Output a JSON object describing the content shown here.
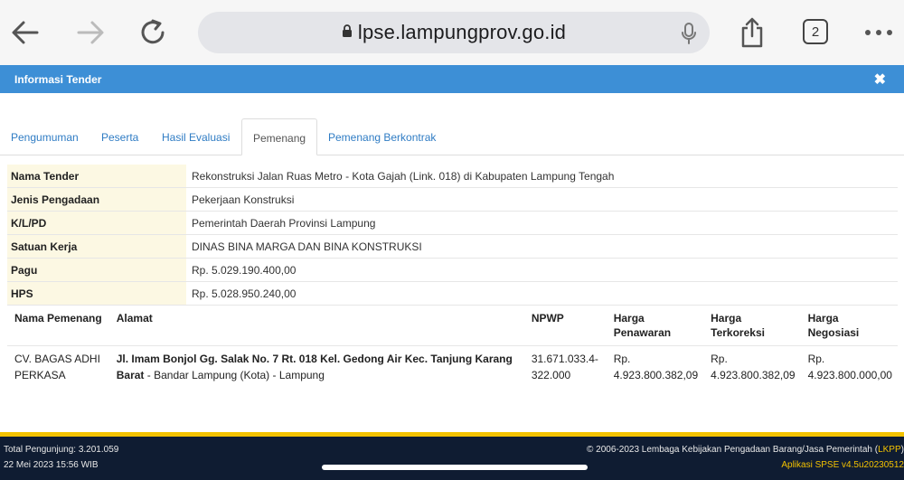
{
  "browser": {
    "url": "lpse.lampungprov.go.id",
    "tab_count": "2"
  },
  "modal": {
    "title": "Informasi Tender",
    "close": "✖"
  },
  "tabs": [
    {
      "label": "Pengumuman"
    },
    {
      "label": "Peserta"
    },
    {
      "label": "Hasil Evaluasi"
    },
    {
      "label": "Pemenang"
    },
    {
      "label": "Pemenang Berkontrak"
    }
  ],
  "info": [
    {
      "label": "Nama Tender",
      "value": "Rekonstruksi Jalan Ruas Metro - Kota Gajah (Link. 018) di Kabupaten Lampung Tengah"
    },
    {
      "label": "Jenis Pengadaan",
      "value": "Pekerjaan Konstruksi"
    },
    {
      "label": "K/L/PD",
      "value": "Pemerintah Daerah Provinsi Lampung"
    },
    {
      "label": "Satuan Kerja",
      "value": "DINAS BINA MARGA DAN BINA KONSTRUKSI"
    },
    {
      "label": "Pagu",
      "value": "Rp. 5.029.190.400,00"
    },
    {
      "label": "HPS",
      "value": "Rp. 5.028.950.240,00"
    }
  ],
  "winner_table": {
    "headers": {
      "name": "Nama Pemenang",
      "address": "Alamat",
      "npwp": "NPWP",
      "offer_1": "Harga",
      "offer_2": "Penawaran",
      "corrected_1": "Harga",
      "corrected_2": "Terkoreksi",
      "negotiated_1": "Harga",
      "negotiated_2": "Negosiasi"
    },
    "row": {
      "name_1": "CV. BAGAS ADHI",
      "name_2": "PERKASA",
      "address_bold_1": "Jl. Imam Bonjol Gg. Salak No. 7 Rt. 018 Kel. Gedong Air Kec. Tanjung Karang",
      "address_bold_2": "Barat",
      "address_rest": " - Bandar Lampung (Kota) - Lampung",
      "npwp_1": "31.671.033.4-",
      "npwp_2": "322.000",
      "offer_1": "Rp.",
      "offer_2": "4.923.800.382,09",
      "corrected_1": "Rp.",
      "corrected_2": "4.923.800.382,09",
      "negotiated_1": "Rp.",
      "negotiated_2": "4.923.800.000,00"
    }
  },
  "footer": {
    "visitors": "Total Pengunjung: 3.201.059",
    "datetime": "22 Mei 2023 15:56 WIB",
    "copyright": "© 2006-2023 Lembaga Kebijakan Pengadaan Barang/Jasa Pemerintah (",
    "lkpp": "LKPP",
    "copyright_end": ")",
    "app_version": "Aplikasi SPSE v4.5u20230512"
  },
  "colors": {
    "modal_header": "#3d8fd6",
    "label_bg": "#fcf8e3",
    "footer_bg": "#0f1c32",
    "footer_accent": "#f3c200"
  }
}
